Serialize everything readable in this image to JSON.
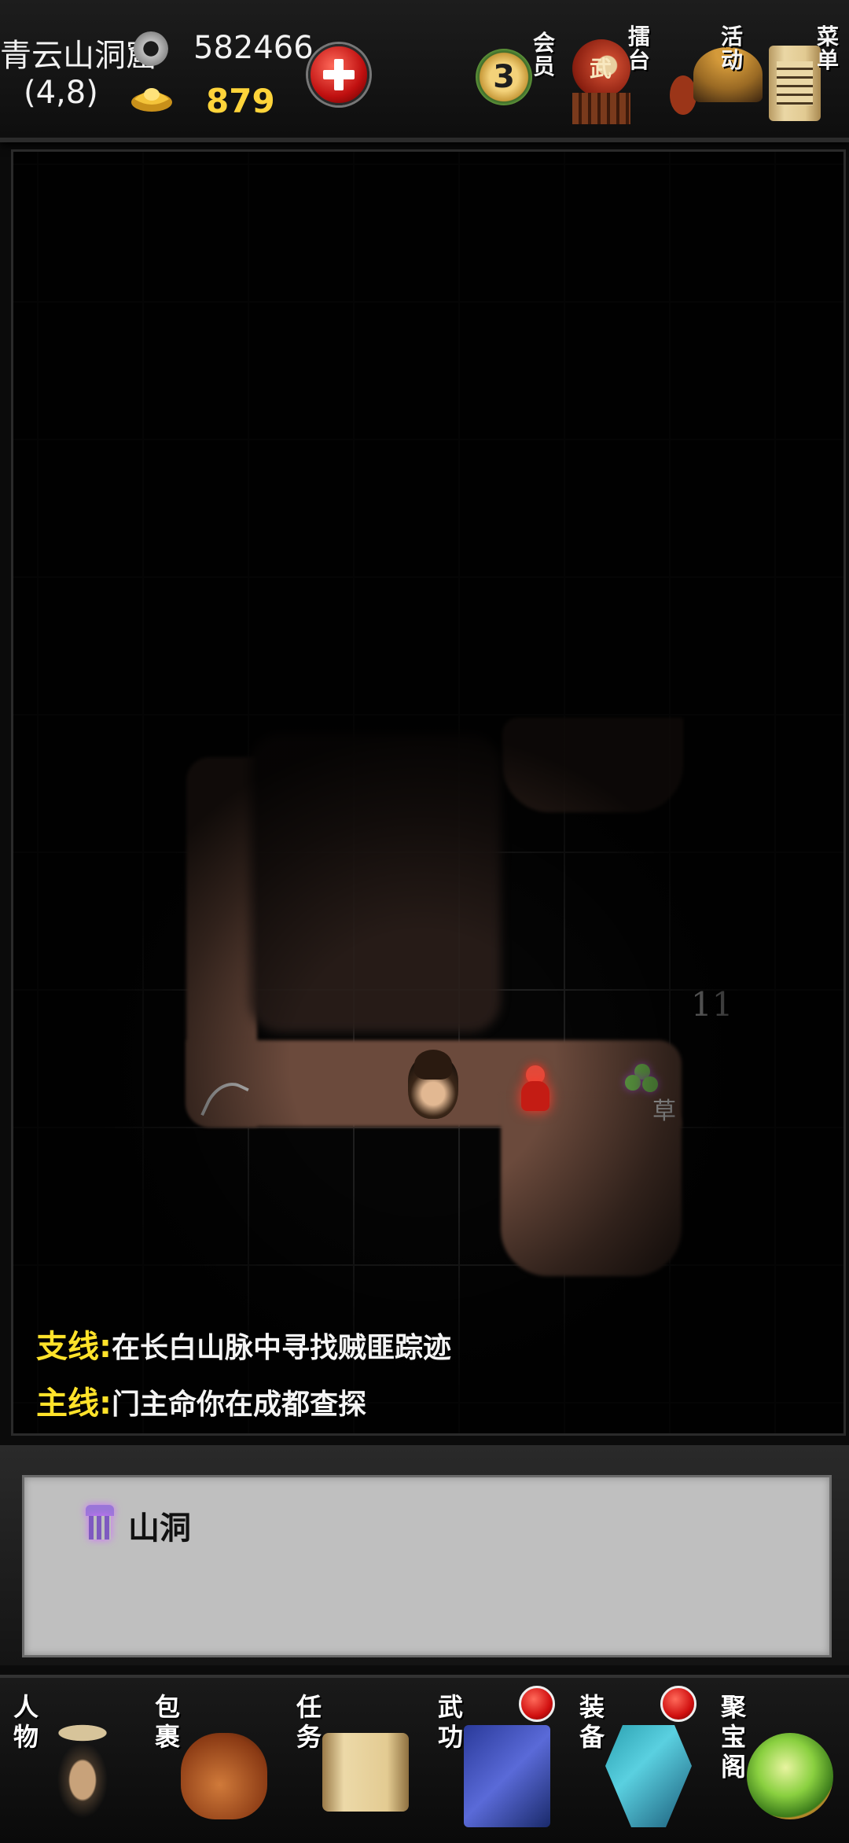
{
  "header": {
    "location": "青云山洞窟",
    "coords": "(4,8)",
    "silver": "582466",
    "gold": "879",
    "vip_level": "3",
    "vip_label": "会员",
    "arena_label": "擂台",
    "arena_char": "武",
    "event_label": "活动",
    "menu_label": "菜单"
  },
  "map": {
    "step_count": "11",
    "herb_label": "草"
  },
  "quests": {
    "side_tag": "支线",
    "side_text": "在长白山脉中寻找贼匪踪迹",
    "main_tag": "主线",
    "main_text": "门主命你在成都查探"
  },
  "info": {
    "text": "山洞"
  },
  "nav": {
    "character": "人物",
    "bag": "包裹",
    "quest": "任务",
    "skill": "武功",
    "equip": "装备",
    "treasure": "聚宝阁"
  },
  "icons": [
    "coin-icon",
    "ingot-icon",
    "add-icon",
    "vip-medal-icon",
    "arena-drum-icon",
    "event-hat-icon",
    "menu-scroll-icon",
    "cave-gate-icon"
  ],
  "colors": {
    "gold": "#ffd43a",
    "quest_tag": "#ffe22a",
    "badge": "#d11010",
    "cave_floor": "#6b4a3c"
  }
}
